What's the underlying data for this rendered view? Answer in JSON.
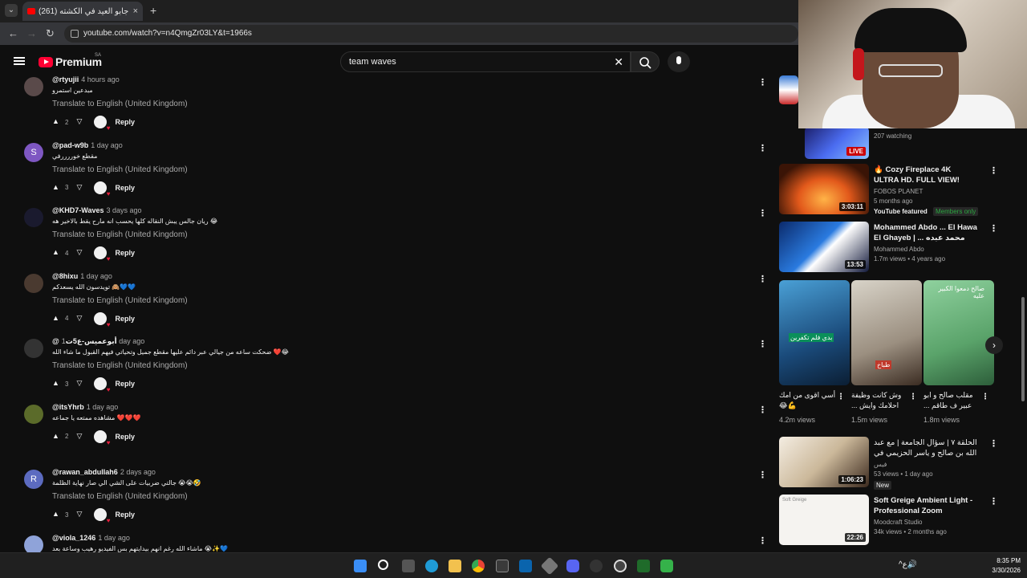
{
  "browser": {
    "tab_title": "جابو العيد في الكشته (261)",
    "tab_close": "×",
    "new_tab": "+",
    "url": "youtube.com/watch?v=n4QmgZr03LY&t=1966s"
  },
  "header": {
    "logo_text": "Premium",
    "country_code": "SA",
    "search_value": "team waves",
    "clear_glyph": "✕"
  },
  "comments": [
    {
      "user": "@rtyujii",
      "time": "4 hours ago",
      "text": "مبدعين استمرو",
      "translate": "Translate to English (United Kingdom)",
      "likes": "2",
      "avatar_letter": "",
      "avatar_color": "#5a4a4a"
    },
    {
      "user": "@pad-w9b",
      "time": "1 day ago",
      "text": "مقطع خوررررفي",
      "translate": "Translate to English (United Kingdom)",
      "likes": "3",
      "avatar_letter": "S",
      "avatar_color": "#7e57c2"
    },
    {
      "user": "@KHD7-Waves",
      "time": "3 days ago",
      "text": "😂 ريان جالس يبش النقاله كلها يحسب انه مارح يقط بالاخير هه",
      "translate": "Translate to English (United Kingdom)",
      "likes": "4",
      "avatar_letter": "",
      "avatar_color": "#1a1a2e"
    },
    {
      "user": "@8hixu",
      "time": "1 day ago",
      "text": "💙💙🙈 تويدسون الله يسعدكم",
      "translate": "Translate to English (United Kingdom)",
      "likes": "4",
      "avatar_letter": "",
      "avatar_color": "#4a3a30"
    },
    {
      "user": "@أبوعميس-ع5ت",
      "time": "1 day ago",
      "text": "😂❤️ ضحكت ساعه من جيالي عبر دائم عليها مقطع جميل وتحياتي فيهم القبول ما شاء الله",
      "translate": "Translate to English (United Kingdom)",
      "likes": "3",
      "avatar_letter": "",
      "avatar_color": "#333"
    },
    {
      "user": "@itsYhrb",
      "time": "1 day ago",
      "text": "❤️❤️❤️ مشاهده ممتعه يا جماعه",
      "translate": "",
      "likes": "2",
      "avatar_letter": "",
      "avatar_color": "#5b6b2a"
    },
    {
      "user": "@rawan_abdullah6",
      "time": "2 days ago",
      "text": "🤣😭😭 جالتي ضربيات على الشي الي صار نهاية الظلمة",
      "translate": "Translate to English (United Kingdom)",
      "likes": "3",
      "avatar_letter": "R",
      "avatar_color": "#5c6bc0"
    },
    {
      "user": "@viola_1246",
      "time": "1 day ago",
      "text": "💙✨😭 ماشاء الله رغم انهم بيدايتهم بس الفيديو رهيب وساعة بعد",
      "translate": "Translate to English (United Kingdom)",
      "likes": "",
      "avatar_letter": "",
      "avatar_color": "#8fa3d9"
    }
  ],
  "reply_label": "Reply",
  "rail": {
    "live": {
      "watching": "207 watching",
      "live_label": "LIVE"
    },
    "videos": [
      {
        "title": "🔥 Cozy Fireplace 4K ULTRA HD. FULL VIEW!",
        "channel": "FOBOS PLANET",
        "meta": "5 months ago",
        "extra": "YouTube featured",
        "badge": "Members only",
        "duration": "3:03:11"
      },
      {
        "title": "Mohammed Abdo ... El Hawa El Ghayeb | محمد عبده ... الهوى الغايب",
        "channel": "Mohammed Abdo",
        "meta": "1.7m views • 4 years ago",
        "duration": "13:53"
      },
      {
        "title": "الحلقة ٧ | سؤال الجامعة | مع عبد الله بن صالح و ياسر الحزيمي في بودكاست فق",
        "channel": "فيس",
        "meta": "53 views • 1 day ago",
        "badge": "New",
        "duration": "1:06:23"
      },
      {
        "title": "Soft Greige Ambient Light - Professional Zoom Backgroun...",
        "channel": "Moodcraft Studio",
        "meta": "34k views • 2 months ago",
        "duration": "22:26",
        "thumb_label": "Soft Greige"
      }
    ],
    "shorts": [
      {
        "title": "أسي اقوى من امك 💪😂",
        "views": "4.2m views",
        "overlay": "بدي فلم تكفرين"
      },
      {
        "title": "وش كانت وظيفة احلامك وايش ...",
        "views": "1.5m views",
        "overlay": "طباخ"
      },
      {
        "title": "مقلب صالح و ابو عبير ف طاقم ...",
        "views": "1.8m views",
        "overlay": "صالح دمعوا الكبير عليه"
      }
    ],
    "next_glyph": "›"
  },
  "taskbar": {
    "time": "8:35 PM",
    "date": "3/30/2026",
    "lang": "ع"
  },
  "colors": {
    "brand": "#ff0033",
    "bg": "#0f0f0f",
    "like_heart": "#e61e3c"
  }
}
